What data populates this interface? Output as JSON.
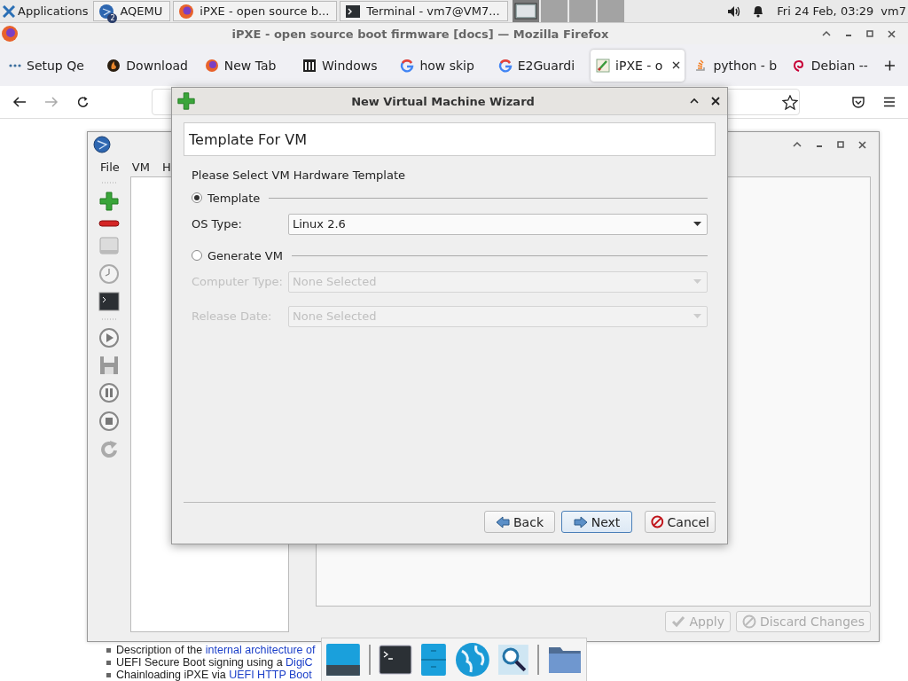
{
  "top_panel": {
    "menu_label": "Applications",
    "tasks": [
      {
        "label": "AQEMU",
        "badge": "2"
      },
      {
        "label": "iPXE - open source b..."
      },
      {
        "label": "Terminal - vm7@VM7..."
      }
    ],
    "clock": "Fri 24 Feb, 03:29",
    "user": "vm7"
  },
  "browser": {
    "title": "iPXE - open source boot firmware [docs] — Mozilla Firefox",
    "tabs": [
      {
        "label": "Setup Qe",
        "selected": false
      },
      {
        "label": "Download",
        "selected": false
      },
      {
        "label": "New Tab",
        "selected": false
      },
      {
        "label": "Windows",
        "selected": false
      },
      {
        "label": "how skip",
        "selected": false
      },
      {
        "label": "E2Guardi",
        "selected": false
      },
      {
        "label": "iPXE - o",
        "selected": true
      },
      {
        "label": "python - b",
        "selected": false
      },
      {
        "label": "Debian --",
        "selected": false
      }
    ],
    "page_list": [
      {
        "text": "Description of the ",
        "link": "internal architecture of"
      },
      {
        "text": "UEFI Secure Boot signing using a ",
        "link": "DigiC"
      },
      {
        "text": "Chainloading iPXE via ",
        "link": "UEFI HTTP Boot"
      }
    ]
  },
  "aqemu": {
    "menu": [
      {
        "label": "File"
      },
      {
        "label": "VM"
      },
      {
        "label": "H"
      }
    ],
    "buttons": [
      {
        "label": "Apply",
        "disabled": true
      },
      {
        "label": "Discard Changes",
        "disabled": true
      }
    ]
  },
  "wizard": {
    "title": "New Virtual Machine Wizard",
    "heading": "Template For VM",
    "prompt": "Please Select VM Hardware Template",
    "groups": [
      {
        "label": "Template",
        "selected": true,
        "fields": [
          {
            "label": "OS Type:",
            "value": "Linux 2.6",
            "disabled": false
          }
        ]
      },
      {
        "label": "Generate VM",
        "selected": false,
        "fields": [
          {
            "label": "Computer Type:",
            "value": "None Selected",
            "disabled": true
          },
          {
            "label": "Release Date:",
            "value": "None Selected",
            "disabled": true
          }
        ]
      }
    ],
    "buttons": [
      {
        "label": "Back",
        "default": false
      },
      {
        "label": "Next",
        "default": true
      },
      {
        "label": "Cancel",
        "default": false
      }
    ]
  }
}
